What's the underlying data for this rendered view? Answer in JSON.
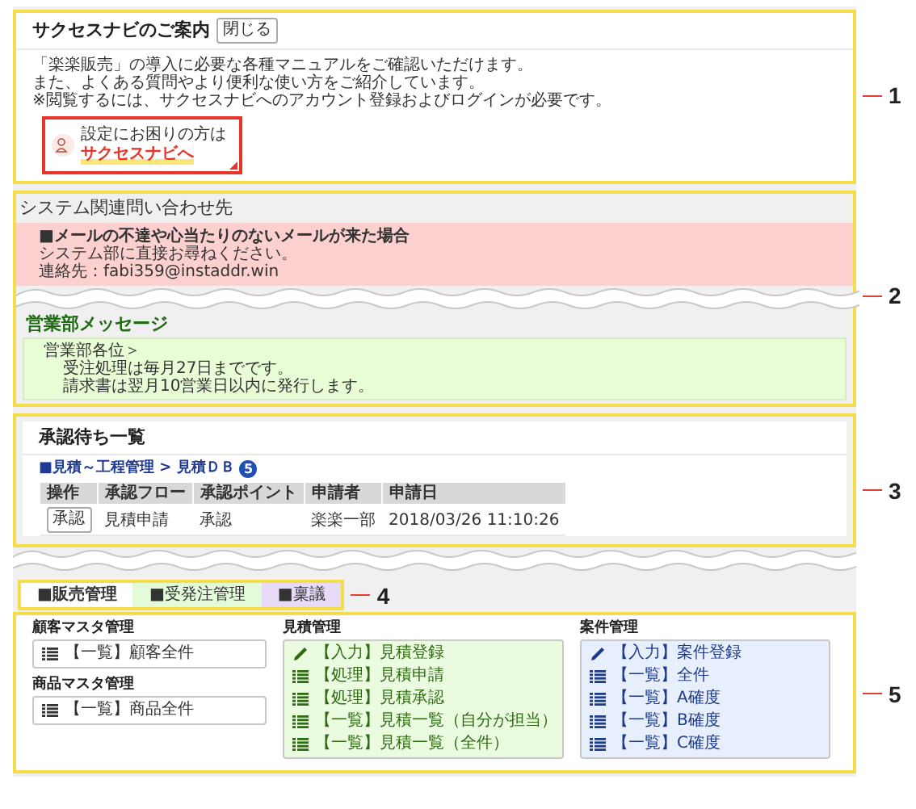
{
  "guide": {
    "title": "サクセスナビのご案内",
    "close_button": "閉じる",
    "lines": [
      "「楽楽販売」の導入に必要な各種マニュアルをご確認いただけます。",
      "また、よくある質問やより便利な使い方をご紹介しています。",
      "※閲覧するには、サクセスナビへのアカウント登録およびログインが必要です。"
    ],
    "banner": {
      "caption": "設定にお困りの方は",
      "link": "サクセスナビへ"
    }
  },
  "contact": {
    "title": "システム関連問い合わせ先",
    "heading": "■メールの不達や心当たりのないメールが来た場合",
    "lines": [
      "システム部に直接お尋ねください。",
      "連絡先：fabi359@instaddr.win"
    ]
  },
  "sales_message": {
    "title": "営業部メッセージ",
    "greeting": "営業部各位＞",
    "lines": [
      "受注処理は毎月27日までです。",
      "請求書は翌月10営業日以内に発行します。"
    ]
  },
  "approvals": {
    "title": "承認待ち一覧",
    "breadcrumb": "■見積～工程管理 > 見積ＤＢ",
    "count": "5",
    "columns": [
      "操作",
      "承認フロー",
      "承認ポイント",
      "申請者",
      "申請日"
    ],
    "rows": [
      {
        "cells": [
          {
            "kind": "button",
            "text": "承認"
          },
          {
            "kind": "text",
            "text": "見積申請"
          },
          {
            "kind": "text",
            "text": "承認"
          },
          {
            "kind": "text",
            "text": "楽楽一部"
          },
          {
            "kind": "text",
            "text": "2018/03/26 11:10:26"
          }
        ]
      }
    ]
  },
  "tabs": [
    {
      "label": "■販売管理",
      "selected": true,
      "color": "#ffffff"
    },
    {
      "label": "■受発注管理",
      "selected": false,
      "color": "#e4fbd9"
    },
    {
      "label": "■稟議",
      "selected": false,
      "color": "#e8dbf8"
    }
  ],
  "menu": [
    {
      "color": "#ffffff",
      "groups": [
        {
          "title": "顧客マスタ管理",
          "items": [
            {
              "kind": "list",
              "label": "【一覧】顧客全件"
            }
          ]
        },
        {
          "title": "商品マスタ管理",
          "items": [
            {
              "kind": "list",
              "label": "【一覧】商品全件"
            }
          ]
        }
      ]
    },
    {
      "color": "#ebfbe0",
      "groups": [
        {
          "title": "見積管理",
          "items": [
            {
              "kind": "edit",
              "label": "【入力】見積登録"
            },
            {
              "kind": "list",
              "label": "【処理】見積申請"
            },
            {
              "kind": "list",
              "label": "【処理】見積承認"
            },
            {
              "kind": "list",
              "label": "【一覧】見積一覧（自分が担当）"
            },
            {
              "kind": "list",
              "label": "【一覧】見積一覧（全件）"
            }
          ]
        }
      ]
    },
    {
      "color": "#e7eefc",
      "groups": [
        {
          "title": "案件管理",
          "items": [
            {
              "kind": "edit",
              "label": "【入力】案件登録"
            },
            {
              "kind": "list",
              "label": "【一覧】全件"
            },
            {
              "kind": "list",
              "label": "【一覧】A確度"
            },
            {
              "kind": "list",
              "label": "【一覧】B確度"
            },
            {
              "kind": "list",
              "label": "【一覧】C確度"
            }
          ]
        }
      ]
    }
  ],
  "callouts": [
    "1",
    "2",
    "3",
    "4",
    "5"
  ]
}
